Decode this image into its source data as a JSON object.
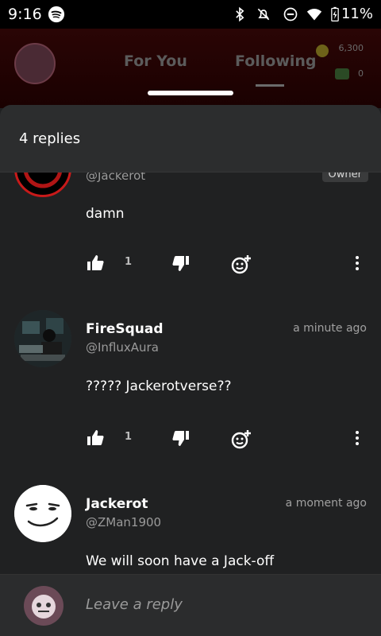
{
  "status_bar": {
    "time": "9:16",
    "battery_pct": "11%",
    "icons": [
      "spotify-icon",
      "bluetooth-icon",
      "notifications-off-icon",
      "do-not-disturb-icon",
      "wifi-icon",
      "battery-charging-icon"
    ]
  },
  "background_app": {
    "tabs": [
      "For You",
      "Following"
    ],
    "active_tab": "Following",
    "coins": "6,300",
    "cash": "0"
  },
  "replies": {
    "title": "4 replies",
    "comments": [
      {
        "name": "",
        "handle": "@Jackerot",
        "badge": "Owner",
        "time": "",
        "body": "damn",
        "likes": "1"
      },
      {
        "name": "FireSquad",
        "handle": "@InfluxAura",
        "time": "a minute ago",
        "body": "????? Jackerotverse??",
        "likes": "1"
      },
      {
        "name": "Jackerot",
        "handle": "@ZMan1900",
        "time": "a moment ago",
        "body": "We will soon have a Jack-off",
        "likes": ""
      }
    ]
  },
  "reply_box": {
    "placeholder": "Leave a reply"
  },
  "colors": {
    "background": "#202122",
    "header": "#2c2d2e",
    "secondary_text": "#9a9a9a"
  }
}
